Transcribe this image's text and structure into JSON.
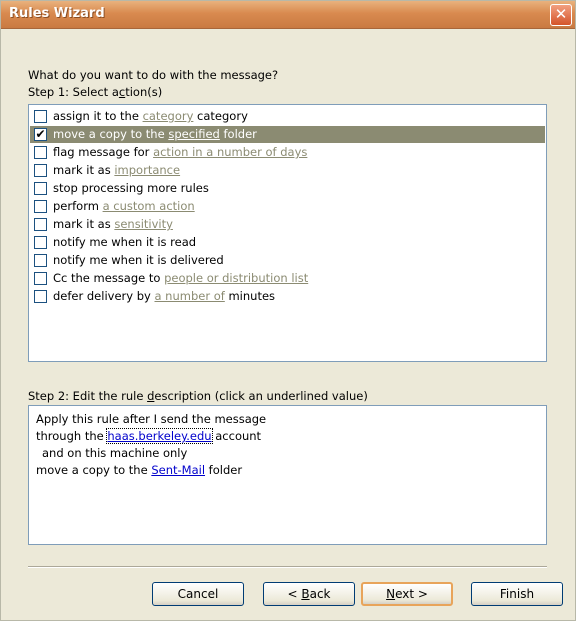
{
  "window": {
    "title": "Rules Wizard",
    "close_glyph": "✕"
  },
  "prompt": "What do you want to do with the message?",
  "step1": {
    "before": "Step 1: Select a",
    "hot": "c",
    "after": "tion(s)"
  },
  "actions": [
    {
      "pre": "assign it to the ",
      "link": "category",
      "post": " category",
      "checked": false
    },
    {
      "pre": "move a copy to the ",
      "link": "specified",
      "post": " folder",
      "checked": true
    },
    {
      "pre": "flag message for ",
      "link": "action in a number of days",
      "post": "",
      "checked": false
    },
    {
      "pre": "mark it as ",
      "link": "importance",
      "post": "",
      "checked": false
    },
    {
      "pre": "stop processing more rules",
      "link": "",
      "post": "",
      "checked": false
    },
    {
      "pre": "perform ",
      "link": "a custom action",
      "post": "",
      "checked": false
    },
    {
      "pre": "mark it as ",
      "link": "sensitivity",
      "post": "",
      "checked": false
    },
    {
      "pre": "notify me when it is read",
      "link": "",
      "post": "",
      "checked": false
    },
    {
      "pre": "notify me when it is delivered",
      "link": "",
      "post": "",
      "checked": false
    },
    {
      "pre": "Cc the message to ",
      "link": "people or distribution list",
      "post": "",
      "checked": false
    },
    {
      "pre": "defer delivery by ",
      "link": "a number of",
      "post": " minutes",
      "checked": false
    }
  ],
  "check_glyph": "✔",
  "step2": {
    "before": "Step 2: Edit the rule ",
    "hot": "d",
    "after": "escription (click an underlined value)"
  },
  "description": {
    "line1": "Apply this rule after I send the message",
    "line2_pre": "through the ",
    "line2_link": "haas.berkeley.edu",
    "line2_post": " account",
    "line3": "and on this machine only",
    "line4_pre": "move a copy to the ",
    "line4_link": "Sent-Mail",
    "line4_post": " folder"
  },
  "buttons": {
    "cancel": "Cancel",
    "back_pre": "< ",
    "back_hot": "B",
    "back_post": "ack",
    "next_hot": "N",
    "next_post": "ext >",
    "finish": "Finish"
  }
}
